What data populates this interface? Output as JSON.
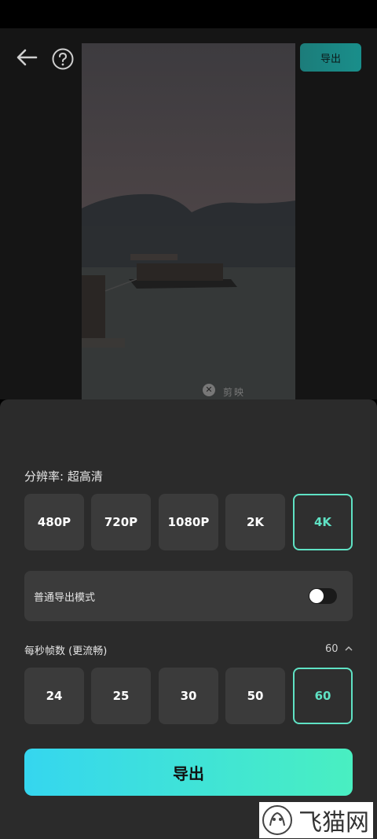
{
  "header": {
    "export_label": "导出"
  },
  "preview": {
    "watermark_text": "剪映"
  },
  "resolution": {
    "label": "分辨率: 超高清",
    "options": [
      "480P",
      "720P",
      "1080P",
      "2K",
      "4K"
    ],
    "selected": "4K"
  },
  "mode": {
    "label": "普通导出模式",
    "enabled": false
  },
  "fps": {
    "label": "每秒帧数 (更流畅)",
    "value": "60",
    "options": [
      "24",
      "25",
      "30",
      "50",
      "60"
    ],
    "selected": "60"
  },
  "export_button": {
    "label": "导出"
  },
  "site_watermark": {
    "text": "飞猫网"
  },
  "colors": {
    "accent": "#5fe2c4",
    "gradient_start": "#35d6ef",
    "gradient_end": "#49efc1",
    "sheet_bg": "#2b2b2b"
  }
}
